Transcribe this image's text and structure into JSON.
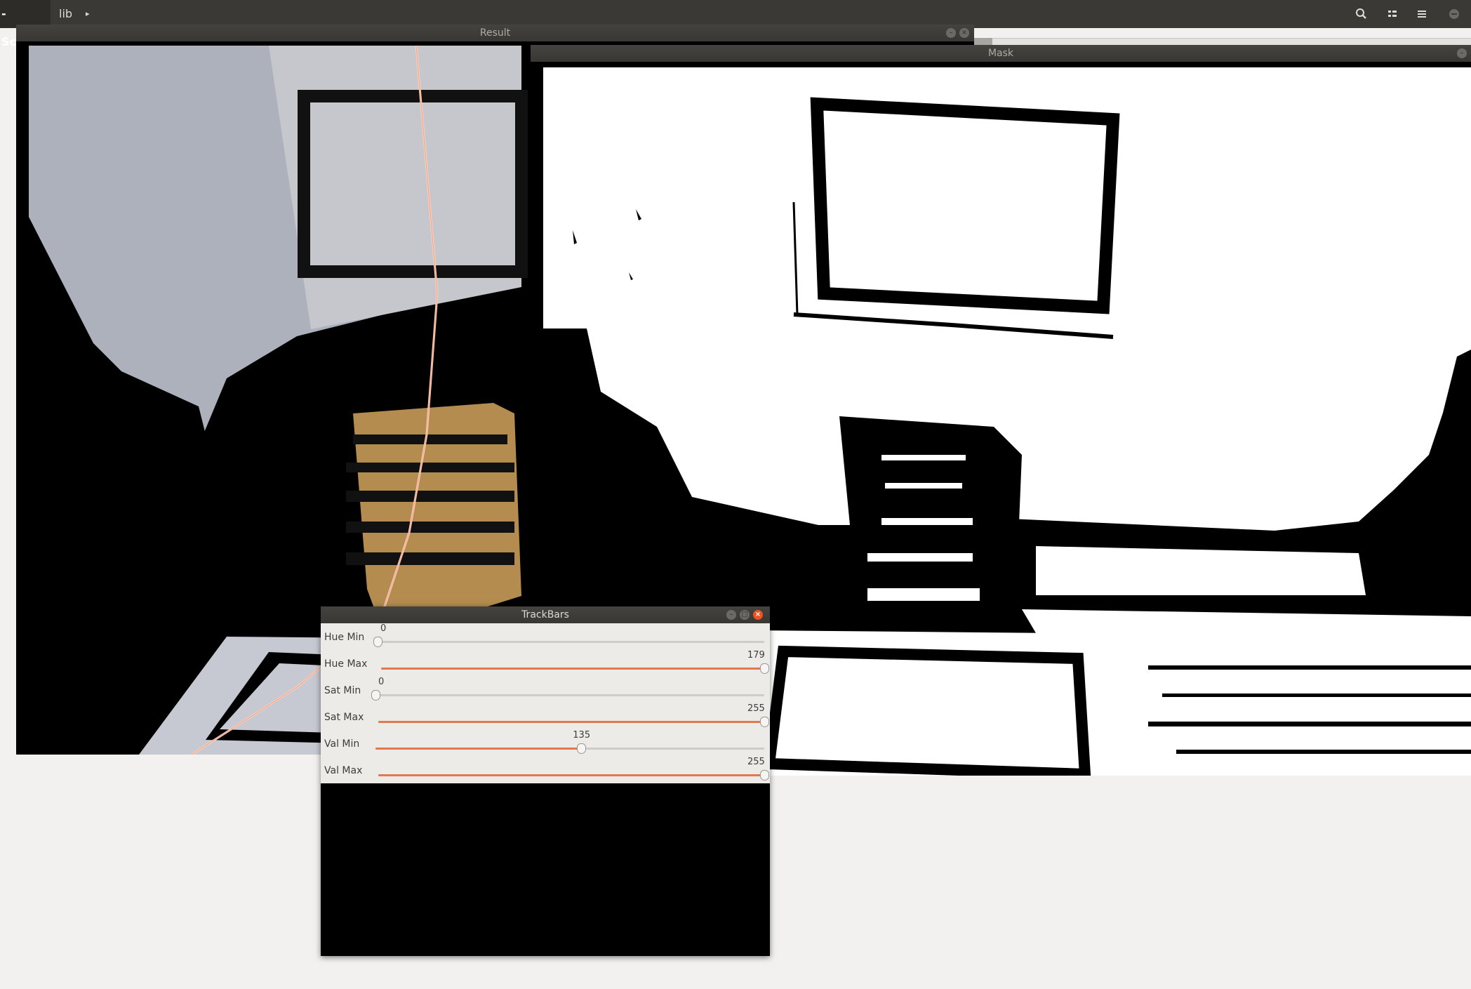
{
  "topbar": {
    "app_crumb": "-Scanner",
    "folder_crumb": "lib",
    "next_arrow": "▸",
    "icons": [
      "search-icon",
      "view-toggle-icon",
      "hamburger-menu-icon",
      "window-minimize-icon"
    ]
  },
  "windows": {
    "result": {
      "title": "Result"
    },
    "mask": {
      "title": "Mask"
    },
    "trackbars": {
      "title": "TrackBars",
      "sliders": [
        {
          "label": "Hue Min",
          "value": "0",
          "max": 179
        },
        {
          "label": "Hue Max",
          "value": "179",
          "max": 179
        },
        {
          "label": "Sat Min",
          "value": "0",
          "max": 255
        },
        {
          "label": "Sat Max",
          "value": "255",
          "max": 255
        },
        {
          "label": "Val Min",
          "value": "135",
          "max": 255
        },
        {
          "label": "Val Max",
          "value": "255",
          "max": 255
        }
      ]
    }
  },
  "colors": {
    "accent": "#e2784e",
    "titlebar": "#3a3935",
    "close_button": "#e95420",
    "laser": "#ffd4c2"
  }
}
